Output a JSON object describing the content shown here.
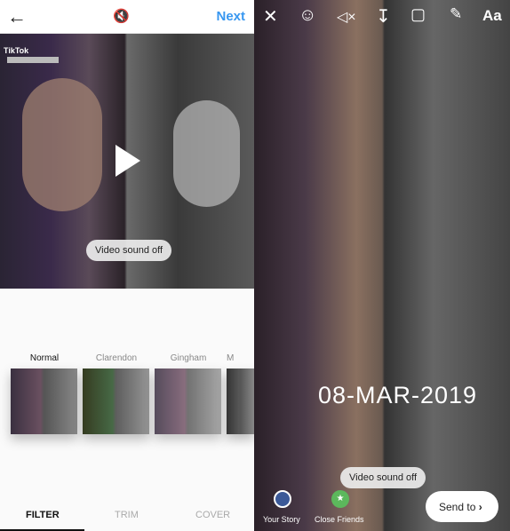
{
  "left": {
    "header": {
      "back_icon": "arrow-left-icon",
      "mute_icon": "speaker-muted-icon",
      "next_label": "Next",
      "accent": "#3897f0"
    },
    "video": {
      "watermark": "TikTok",
      "toast": "Video sound off",
      "play_icon": "play-icon"
    },
    "filters": [
      {
        "label": "Normal"
      },
      {
        "label": "Clarendon"
      },
      {
        "label": "Gingham"
      },
      {
        "label": "M"
      }
    ],
    "tabs": [
      {
        "label": "FILTER"
      },
      {
        "label": "TRIM"
      },
      {
        "label": "COVER"
      }
    ]
  },
  "right": {
    "toolbar": [
      "close-icon",
      "face-effects-icon",
      "mute-icon",
      "download-icon",
      "sticker-icon",
      "draw-icon"
    ],
    "text_tool": "Aa",
    "date_sticker": "08-MAR-2019",
    "toast": "Video sound off",
    "share": [
      {
        "label": "Your Story"
      },
      {
        "label": "Close Friends"
      }
    ],
    "send_label": "Send to"
  }
}
